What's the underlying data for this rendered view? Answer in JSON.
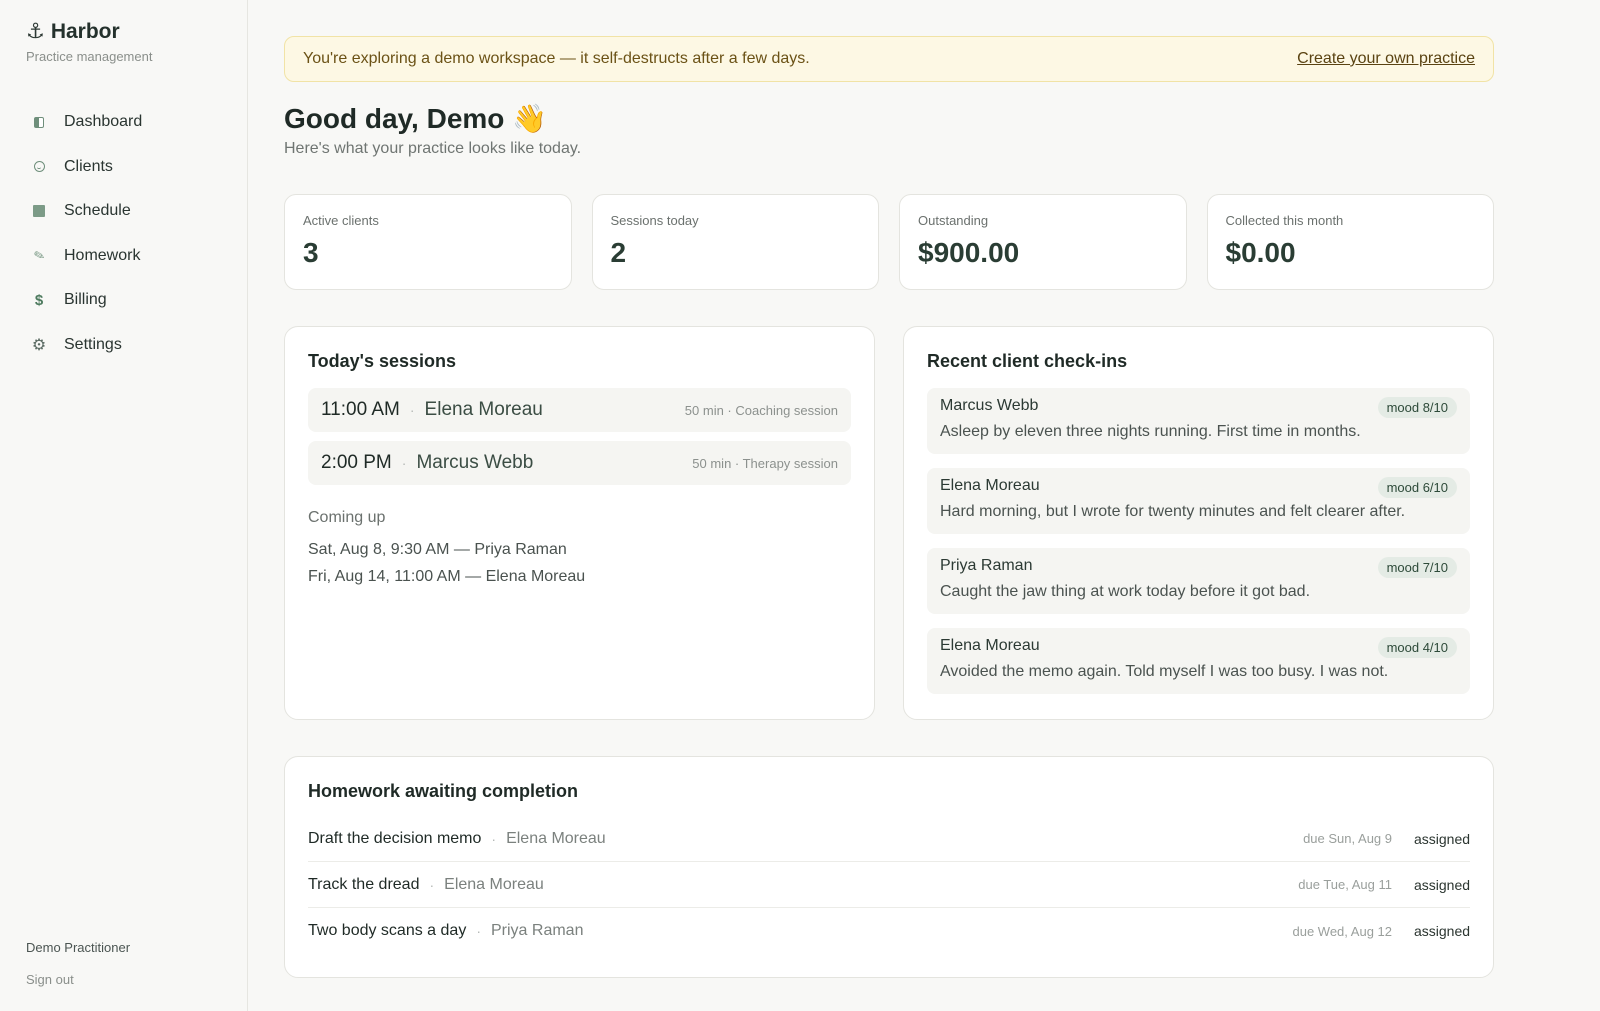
{
  "app": {
    "name": "Harbor",
    "subtitle": "Practice management",
    "anchor_glyph": "⚓"
  },
  "sidebar": {
    "items": [
      {
        "label": "Dashboard",
        "icon": "dashboard-icon"
      },
      {
        "label": "Clients",
        "icon": "clients-icon"
      },
      {
        "label": "Schedule",
        "icon": "schedule-icon"
      },
      {
        "label": "Homework",
        "icon": "homework-icon"
      },
      {
        "label": "Billing",
        "icon": "dollar-icon"
      },
      {
        "label": "Settings",
        "icon": "gear-icon"
      }
    ],
    "user_name": "Demo Practitioner",
    "sign_out": "Sign out"
  },
  "banner": {
    "text": "You're exploring a demo workspace — it self-destructs after a few days.",
    "link": "Create your own practice"
  },
  "greeting": {
    "title": "Good day, Demo",
    "emoji": "👋",
    "subtitle": "Here's what your practice looks like today."
  },
  "stats": [
    {
      "label": "Active clients",
      "value": "3"
    },
    {
      "label": "Sessions today",
      "value": "2"
    },
    {
      "label": "Outstanding",
      "value": "$900.00"
    },
    {
      "label": "Collected this month",
      "value": "$0.00"
    }
  ],
  "sessions": {
    "title": "Today's sessions",
    "items": [
      {
        "time": "11:00 AM",
        "client": "Elena Moreau",
        "meta": "50 min · Coaching session"
      },
      {
        "time": "2:00 PM",
        "client": "Marcus Webb",
        "meta": "50 min · Therapy session"
      }
    ],
    "upcoming_title": "Coming up",
    "upcoming": [
      "Sat, Aug 8, 9:30 AM — Priya Raman",
      "Fri, Aug 14, 11:00 AM — Elena Moreau"
    ]
  },
  "checkins": {
    "title": "Recent client check-ins",
    "items": [
      {
        "name": "Marcus Webb",
        "mood": "mood 8/10",
        "text": "Asleep by eleven three nights running. First time in months."
      },
      {
        "name": "Elena Moreau",
        "mood": "mood 6/10",
        "text": "Hard morning, but I wrote for twenty minutes and felt clearer after."
      },
      {
        "name": "Priya Raman",
        "mood": "mood 7/10",
        "text": "Caught the jaw thing at work today before it got bad."
      },
      {
        "name": "Elena Moreau",
        "mood": "mood 4/10",
        "text": "Avoided the memo again. Told myself I was too busy. I was not."
      }
    ]
  },
  "homework": {
    "title": "Homework awaiting completion",
    "items": [
      {
        "title": "Draft the decision memo",
        "client": "Elena Moreau",
        "due": "due Sun, Aug 9",
        "status": "assigned"
      },
      {
        "title": "Track the dread",
        "client": "Elena Moreau",
        "due": "due Tue, Aug 11",
        "status": "assigned"
      },
      {
        "title": "Two body scans a day",
        "client": "Priya Raman",
        "due": "due Wed, Aug 12",
        "status": "assigned"
      }
    ]
  },
  "separator": "·",
  "colors": {
    "accent": "#6f8f7b",
    "banner_bg": "#fdf8e4",
    "banner_text": "#6b5216",
    "mood_badge_bg": "#e4ebe5"
  }
}
